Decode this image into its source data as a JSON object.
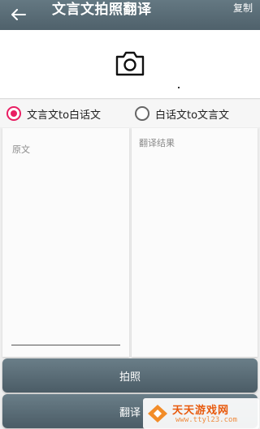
{
  "header": {
    "title": "文言文拍照翻译",
    "copy_label": "复制",
    "back_icon": "arrow-left-icon",
    "colors": {
      "background": "#56686f",
      "text": "#ffffff"
    }
  },
  "camera": {
    "icon": "camera-icon"
  },
  "modes": [
    {
      "label": "文言文to白话文",
      "checked": true
    },
    {
      "label": "白话文to文言文",
      "checked": false
    }
  ],
  "source": {
    "placeholder": "原文",
    "value": ""
  },
  "result": {
    "placeholder": "翻译结果"
  },
  "buttons": {
    "shoot_label": "拍照",
    "translate_label": "翻译"
  },
  "watermark": {
    "title": "天天游戏网",
    "url": "www.ttyl23.com"
  },
  "accent_color": "#e91e63"
}
